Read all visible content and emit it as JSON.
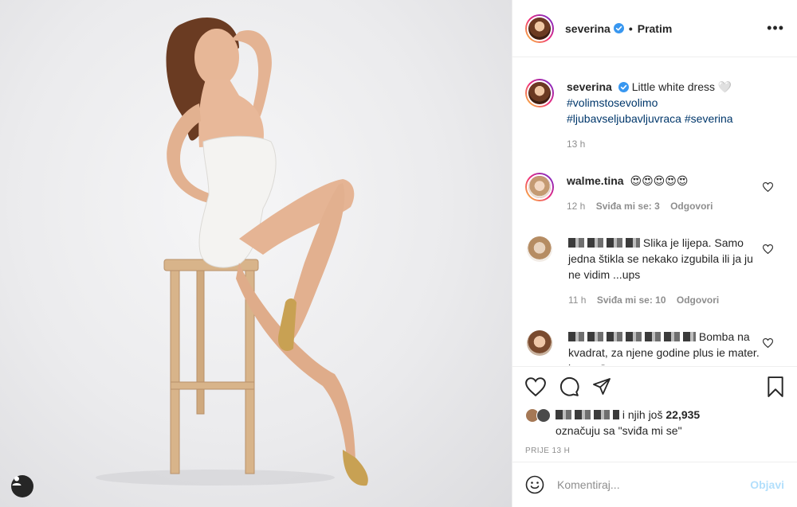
{
  "post": {
    "author": "severina",
    "follow_state": "Pratim",
    "more": "•••",
    "caption_text": "Little white dress 🤍",
    "hashtags": [
      "#volimstosevolimo",
      "#ljubavseljubavljuvraca",
      "#severina"
    ],
    "caption_age": "13 h",
    "likes_suffix": "i njih još",
    "likes_count": "22,935",
    "likes_line2": "označuju sa \"sviđa mi se\"",
    "post_age": "PRIJE 13 H"
  },
  "comments": [
    {
      "user": "walme.tina",
      "text": "😍😍😍😍😍",
      "age": "12 h",
      "likes": "Sviđa mi se: 3",
      "reply": "Odgovori"
    },
    {
      "user": "",
      "text": "Slika je lijepa. Samo jedna štikla se nekako izgubila ili ja ju ne vidim ...ups",
      "age": "11 h",
      "likes": "Sviđa mi se: 10",
      "reply": "Odgovori"
    },
    {
      "user": "",
      "text": "Bomba na kvadrat, za njene godine plus ie mater. bravo Seve.❤",
      "age": "",
      "likes": "",
      "reply": ""
    }
  ],
  "composer": {
    "placeholder": "Komentiraj...",
    "post_label": "Objavi"
  },
  "icons": {
    "header_more": "more-icon",
    "like": "heart-icon",
    "comment": "comment-icon",
    "share": "share-icon",
    "save": "bookmark-icon",
    "emoji": "emoji-icon",
    "tag": "user-tag-icon",
    "verified": "verified-badge-icon"
  },
  "colors": {
    "verified": "#3897f0",
    "hashtag": "#00376b",
    "muted": "#8e8e8e",
    "post_button_disabled": "#b2dffc"
  }
}
